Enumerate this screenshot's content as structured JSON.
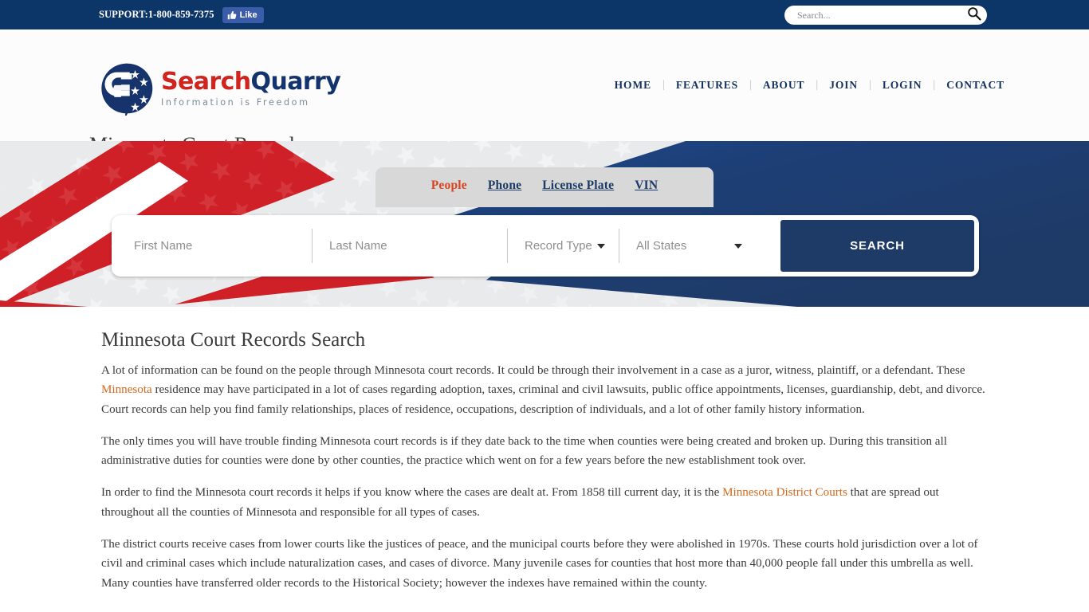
{
  "topbar": {
    "support": "SUPPORT:1-800-859-7375",
    "like_label": "Like",
    "like_icon": "thumbs-up-icon",
    "search_placeholder": "Search...",
    "search_value": "",
    "search_icon": "magnifier-icon",
    "bg_color": "#0c3568"
  },
  "header": {
    "logo_name_part1": "Search",
    "logo_name_part2": "Quarry",
    "logo_tagline": "Information is Freedom",
    "logo_red": "#d0241f",
    "logo_navy": "#12336b",
    "nav": [
      {
        "label": "HOME"
      },
      {
        "label": "FEATURES"
      },
      {
        "label": "ABOUT"
      },
      {
        "label": "JOIN"
      },
      {
        "label": "LOGIN"
      },
      {
        "label": "CONTACT"
      }
    ],
    "separator": "|",
    "page_title": "Minnesota Court Records"
  },
  "hero": {
    "bg_color": "#1e3a66",
    "tabs": [
      {
        "label": "People",
        "active": true
      },
      {
        "label": "Phone",
        "active": false
      },
      {
        "label": "License Plate",
        "active": false
      },
      {
        "label": "VIN",
        "active": false
      }
    ],
    "active_tab_color": "#d9441f",
    "tab_color": "#1c3a66",
    "form": {
      "first_name_placeholder": "First Name",
      "first_name_value": "",
      "last_name_placeholder": "Last Name",
      "last_name_value": "",
      "record_type_label": "Record Type",
      "state_label": "All States",
      "search_button": "SEARCH",
      "button_color": "#1e3a66"
    }
  },
  "article": {
    "heading": "Minnesota Court Records Search",
    "link_color": "#d2691e",
    "p1_a": "A lot of information can be found on the people through Minnesota court records. It could be through their involvement in a case as a juror, witness, plaintiff, or a defendant. These ",
    "p1_link": "Minnesota",
    "p1_b": " residence may have participated in a lot of cases regarding adoption, taxes, criminal and civil lawsuits, public office appointments, licenses, guardianship, debt, and divorce. Court records can help you find family relationships, places of residence, occupations, description of individuals, and a lot of other family history information.",
    "p2": "The only times you will have trouble finding Minnesota court records is if they date back to the time when counties were being created and broken up. During this transition all administrative duties for counties were done by other counties, the practice which went on for a few years before the new establishment took over.",
    "p3_a": "In order to find the Minnesota court records it helps if you know where the cases are dealt at. From 1858 till current day, it is the ",
    "p3_link": "Minnesota District Courts",
    "p3_b": " that are spread out throughout all the counties of Minnesota and responsible for all types of cases.",
    "p4": "The district courts receive cases from lower courts like the justices of peace, and the municipal courts before they were abolished in 1970s. These courts hold jurisdiction over a lot of civil and criminal cases which include naturalization cases, and cases of divorce. Many juvenile cases for counties that host more than 40,000 people fall under this umbrella as well. Many counties have transferred older records to the Historical Society; however the indexes have remained within the county."
  }
}
